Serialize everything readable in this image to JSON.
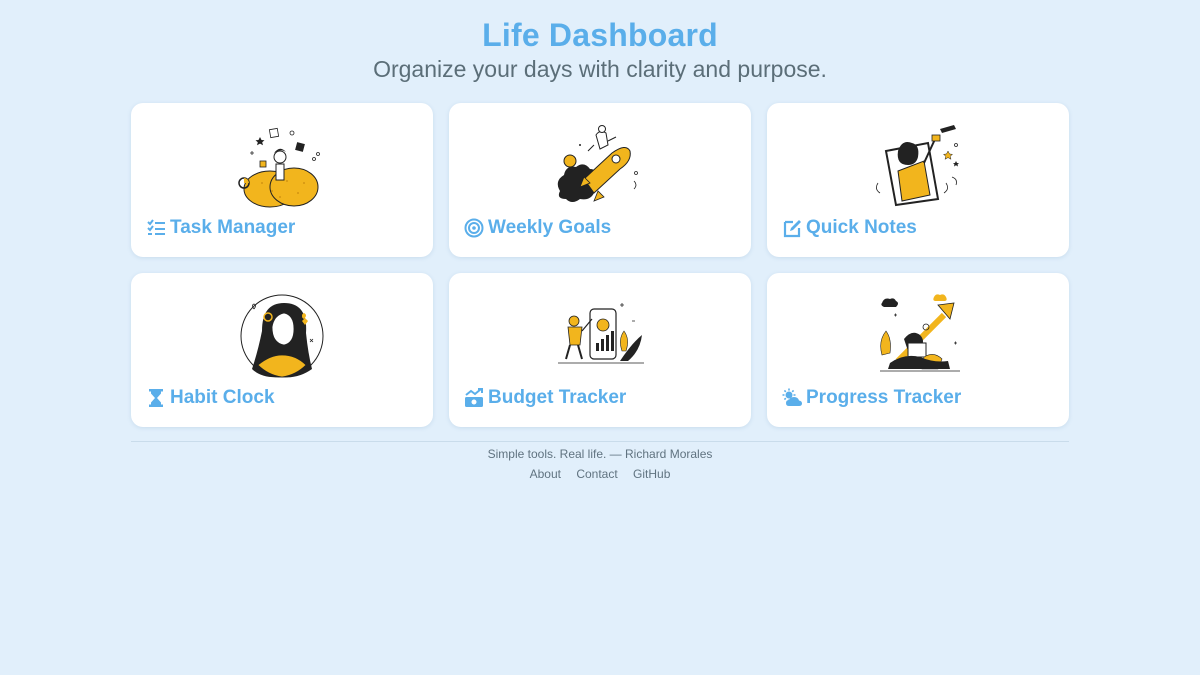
{
  "header": {
    "title": "Life Dashboard",
    "subtitle": "Organize your days with clarity and purpose."
  },
  "cards": [
    {
      "label": "Task Manager",
      "icon": "task-list-icon",
      "illustration": "person-with-tasks-illustration"
    },
    {
      "label": "Weekly Goals",
      "icon": "target-icon",
      "illustration": "rocket-launch-illustration"
    },
    {
      "label": "Quick Notes",
      "icon": "edit-note-icon",
      "illustration": "celebrating-person-frame-illustration"
    },
    {
      "label": "Habit Clock",
      "icon": "hourglass-icon",
      "illustration": "woman-portrait-circle-illustration"
    },
    {
      "label": "Budget Tracker",
      "icon": "money-growth-icon",
      "illustration": "phone-growth-chart-illustration"
    },
    {
      "label": "Progress Tracker",
      "icon": "sun-cloud-icon",
      "illustration": "person-laptop-growth-arrow-illustration"
    }
  ],
  "footer": {
    "tagline": "Simple tools. Real life. — Richard Morales",
    "links": [
      "About",
      "Contact",
      "GitHub"
    ]
  },
  "colors": {
    "background": "#e1effb",
    "accent": "#5aaeea",
    "illustration_yellow": "#f2b51d",
    "text_muted": "#607380"
  }
}
